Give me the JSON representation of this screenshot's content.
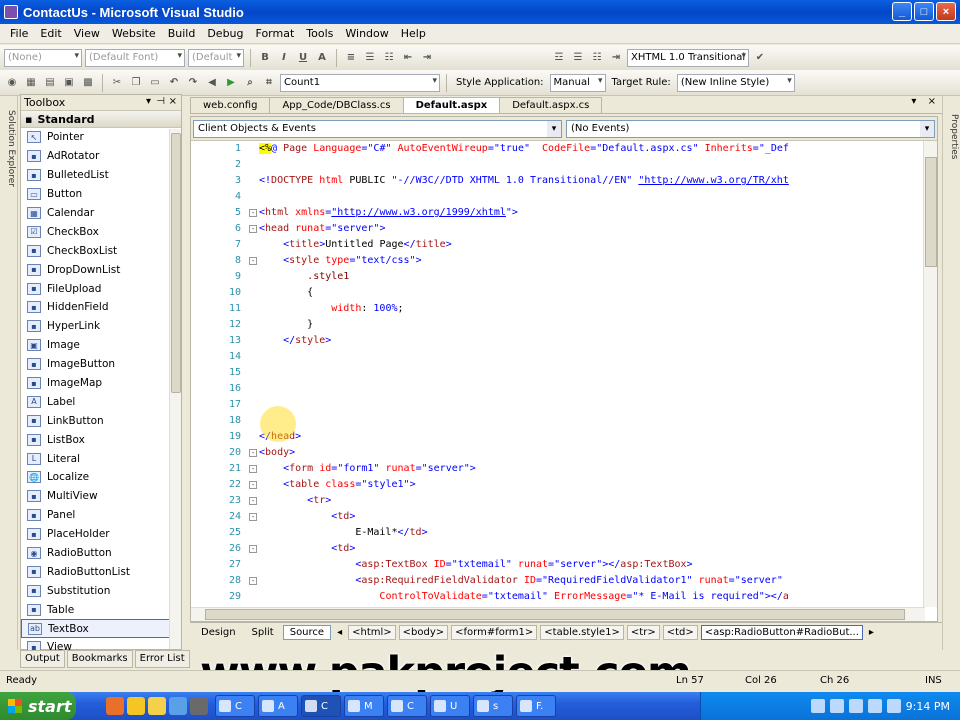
{
  "window": {
    "title": "ContactUs - Microsoft Visual Studio",
    "controls": [
      "_",
      "□",
      "×"
    ]
  },
  "menu": [
    "File",
    "Edit",
    "View",
    "Website",
    "Build",
    "Debug",
    "Format",
    "Tools",
    "Window",
    "Help"
  ],
  "toolbar1": {
    "block_format": "(None)",
    "font": "(Default Font)",
    "size": "(Default",
    "bold": "B",
    "italic": "I",
    "underline": "U",
    "doctype": "XHTML 1.0 Transitional ("
  },
  "toolbar2": {
    "find_value": "Count1",
    "style_application_label": "Style Application:",
    "style_application_value": "Manual",
    "target_rule_label": "Target Rule:",
    "target_rule_value": "(New Inline Style)"
  },
  "toolbox": {
    "title": "Toolbox",
    "group": "Standard",
    "items": [
      "Pointer",
      "AdRotator",
      "BulletedList",
      "Button",
      "Calendar",
      "CheckBox",
      "CheckBoxList",
      "DropDownList",
      "FileUpload",
      "HiddenField",
      "HyperLink",
      "Image",
      "ImageButton",
      "ImageMap",
      "Label",
      "LinkButton",
      "ListBox",
      "Literal",
      "Localize",
      "MultiView",
      "Panel",
      "PlaceHolder",
      "RadioButton",
      "RadioButtonList",
      "Substitution",
      "Table",
      "TextBox",
      "View"
    ],
    "selected": "TextBox",
    "bottom_tabs": [
      "Output",
      "Bookmarks",
      "Error List"
    ]
  },
  "side_tabs": {
    "left": "Solution Explorer",
    "right": "Properties"
  },
  "doc_tabs": [
    "web.config",
    "App_Code/DBClass.cs",
    "Default.aspx",
    "Default.aspx.cs"
  ],
  "active_doc_tab": "Default.aspx",
  "editor": {
    "object_combo": "Client Objects & Events",
    "event_combo": "(No Events)",
    "code_lines": [
      {
        "n": "1",
        "fold": "",
        "parts": [
          [
            "hl",
            "<%"
          ],
          [
            "br",
            "@ "
          ],
          [
            "tg",
            "Page "
          ],
          [
            "at",
            "Language"
          ],
          [
            "br",
            "="
          ],
          [
            "v",
            "\"C#\" "
          ],
          [
            "at",
            "AutoEventWireup"
          ],
          [
            "br",
            "="
          ],
          [
            "v",
            "\"true\"  "
          ],
          [
            "at",
            "CodeFile"
          ],
          [
            "br",
            "="
          ],
          [
            "v",
            "\"Default.aspx.cs\" "
          ],
          [
            "at",
            "Inherits"
          ],
          [
            "br",
            "="
          ],
          [
            "v",
            "\"_Def"
          ]
        ]
      },
      {
        "n": "2",
        "fold": "",
        "parts": []
      },
      {
        "n": "3",
        "fold": "",
        "parts": [
          [
            "br",
            "<!"
          ],
          [
            "tg",
            "DOCTYPE "
          ],
          [
            "at",
            "html "
          ],
          [
            "tx",
            "PUBLIC "
          ],
          [
            "v",
            "\"-//W3C//DTD XHTML 1.0 Transitional//EN\" "
          ],
          [
            "u",
            "\"http://www.w3.org/TR/xht"
          ]
        ]
      },
      {
        "n": "4",
        "fold": "",
        "parts": []
      },
      {
        "n": "5",
        "fold": "-",
        "parts": [
          [
            "br",
            "<"
          ],
          [
            "tg",
            "html "
          ],
          [
            "at",
            "xmlns"
          ],
          [
            "br",
            "="
          ],
          [
            "u",
            "\"http://www.w3.org/1999/xhtml"
          ],
          [
            "v",
            "\""
          ],
          [
            "br",
            ">"
          ]
        ]
      },
      {
        "n": "6",
        "fold": "-",
        "parts": [
          [
            "br",
            "<"
          ],
          [
            "tg",
            "head "
          ],
          [
            "at",
            "runat"
          ],
          [
            "br",
            "="
          ],
          [
            "v",
            "\"server\""
          ],
          [
            "br",
            ">"
          ]
        ]
      },
      {
        "n": "7",
        "fold": "",
        "parts": [
          [
            "tx",
            "    "
          ],
          [
            "br",
            "<"
          ],
          [
            "tg",
            "title"
          ],
          [
            "br",
            ">"
          ],
          [
            "tx",
            "Untitled Page"
          ],
          [
            "br",
            "</"
          ],
          [
            "tg",
            "title"
          ],
          [
            "br",
            ">"
          ]
        ]
      },
      {
        "n": "8",
        "fold": "-",
        "parts": [
          [
            "tx",
            "    "
          ],
          [
            "br",
            "<"
          ],
          [
            "tg",
            "style "
          ],
          [
            "at",
            "type"
          ],
          [
            "br",
            "="
          ],
          [
            "v",
            "\"text/css\""
          ],
          [
            "br",
            ">"
          ]
        ]
      },
      {
        "n": "9",
        "fold": "",
        "parts": [
          [
            "tx",
            "        "
          ],
          [
            "cs",
            ".style1"
          ]
        ]
      },
      {
        "n": "10",
        "fold": "",
        "parts": [
          [
            "tx",
            "        {"
          ]
        ]
      },
      {
        "n": "11",
        "fold": "",
        "parts": [
          [
            "tx",
            "            "
          ],
          [
            "at",
            "width"
          ],
          [
            "tx",
            ": "
          ],
          [
            "v",
            "100%"
          ],
          [
            "tx",
            ";"
          ]
        ]
      },
      {
        "n": "12",
        "fold": "",
        "parts": [
          [
            "tx",
            "        }"
          ]
        ]
      },
      {
        "n": "13",
        "fold": "",
        "parts": [
          [
            "tx",
            "    "
          ],
          [
            "br",
            "</"
          ],
          [
            "tg",
            "style"
          ],
          [
            "br",
            ">"
          ]
        ]
      },
      {
        "n": "14",
        "fold": "",
        "parts": []
      },
      {
        "n": "15",
        "fold": "",
        "parts": []
      },
      {
        "n": "16",
        "fold": "",
        "parts": []
      },
      {
        "n": "17",
        "fold": "",
        "parts": []
      },
      {
        "n": "18",
        "fold": "",
        "parts": []
      },
      {
        "n": "19",
        "fold": "",
        "parts": [
          [
            "br",
            "</"
          ],
          [
            "tg",
            "head"
          ],
          [
            "br",
            ">"
          ]
        ]
      },
      {
        "n": "20",
        "fold": "-",
        "parts": [
          [
            "br",
            "<"
          ],
          [
            "tg",
            "body"
          ],
          [
            "br",
            ">"
          ]
        ]
      },
      {
        "n": "21",
        "fold": "-",
        "parts": [
          [
            "tx",
            "    "
          ],
          [
            "br",
            "<"
          ],
          [
            "tg",
            "form "
          ],
          [
            "at",
            "id"
          ],
          [
            "br",
            "="
          ],
          [
            "v",
            "\"form1\" "
          ],
          [
            "at",
            "runat"
          ],
          [
            "br",
            "="
          ],
          [
            "v",
            "\"server\""
          ],
          [
            "br",
            ">"
          ]
        ]
      },
      {
        "n": "22",
        "fold": "-",
        "parts": [
          [
            "tx",
            "    "
          ],
          [
            "br",
            "<"
          ],
          [
            "tg",
            "table "
          ],
          [
            "at",
            "class"
          ],
          [
            "br",
            "="
          ],
          [
            "v",
            "\"style1\""
          ],
          [
            "br",
            ">"
          ]
        ]
      },
      {
        "n": "23",
        "fold": "-",
        "parts": [
          [
            "tx",
            "        "
          ],
          [
            "br",
            "<"
          ],
          [
            "tg",
            "tr"
          ],
          [
            "br",
            ">"
          ]
        ]
      },
      {
        "n": "24",
        "fold": "-",
        "parts": [
          [
            "tx",
            "            "
          ],
          [
            "br",
            "<"
          ],
          [
            "tg",
            "td"
          ],
          [
            "br",
            ">"
          ]
        ]
      },
      {
        "n": "25",
        "fold": "",
        "parts": [
          [
            "tx",
            "                E-Mail*"
          ],
          [
            "br",
            "</"
          ],
          [
            "tg",
            "td"
          ],
          [
            "br",
            ">"
          ]
        ]
      },
      {
        "n": "26",
        "fold": "-",
        "parts": [
          [
            "tx",
            "            "
          ],
          [
            "br",
            "<"
          ],
          [
            "tg",
            "td"
          ],
          [
            "br",
            ">"
          ]
        ]
      },
      {
        "n": "27",
        "fold": "",
        "parts": [
          [
            "tx",
            "                "
          ],
          [
            "br",
            "<"
          ],
          [
            "tg",
            "asp:TextBox "
          ],
          [
            "at",
            "ID"
          ],
          [
            "br",
            "="
          ],
          [
            "v",
            "\"txtemail\" "
          ],
          [
            "at",
            "runat"
          ],
          [
            "br",
            "="
          ],
          [
            "v",
            "\"server\""
          ],
          [
            "br",
            "></"
          ],
          [
            "tg",
            "asp:TextBox"
          ],
          [
            "br",
            ">"
          ]
        ]
      },
      {
        "n": "28",
        "fold": "-",
        "parts": [
          [
            "tx",
            "                "
          ],
          [
            "br",
            "<"
          ],
          [
            "tg",
            "asp:RequiredFieldValidator "
          ],
          [
            "at",
            "ID"
          ],
          [
            "br",
            "="
          ],
          [
            "v",
            "\"RequiredFieldValidator1\" "
          ],
          [
            "at",
            "runat"
          ],
          [
            "br",
            "="
          ],
          [
            "v",
            "\"server\""
          ]
        ]
      },
      {
        "n": "29",
        "fold": "",
        "parts": [
          [
            "tx",
            "                    "
          ],
          [
            "at",
            "ControlToValidate"
          ],
          [
            "br",
            "="
          ],
          [
            "v",
            "\"txtemail\" "
          ],
          [
            "at",
            "ErrorMessage"
          ],
          [
            "br",
            "="
          ],
          [
            "v",
            "\"* E-Mail is required\""
          ],
          [
            "br",
            "></"
          ],
          [
            "tg",
            "a"
          ]
        ]
      }
    ]
  },
  "viewbar": {
    "buttons": [
      "Design",
      "Split",
      "Source"
    ],
    "active": "Source",
    "crumbs": [
      "<html>",
      "<body>",
      "<form#form1>",
      "<table.style1>",
      "<tr>",
      "<td>",
      "<asp:RadioButton#RadioBut..."
    ]
  },
  "status": {
    "ready": "Ready",
    "ln": "Ln 57",
    "col": "Col 26",
    "ch": "Ch 26",
    "ins": "INS"
  },
  "watermark": "www.pakproject.com",
  "taskbar": {
    "start": "start",
    "tasks": [
      "C",
      "A",
      "C",
      "M",
      "C",
      "U",
      "s",
      "F."
    ],
    "clock": "9:14 PM"
  },
  "colors": {
    "accent": "#0347c8",
    "start_green": "#3fa33f",
    "tag": "#a31515",
    "attr": "#ff0000",
    "value": "#0000ff"
  }
}
